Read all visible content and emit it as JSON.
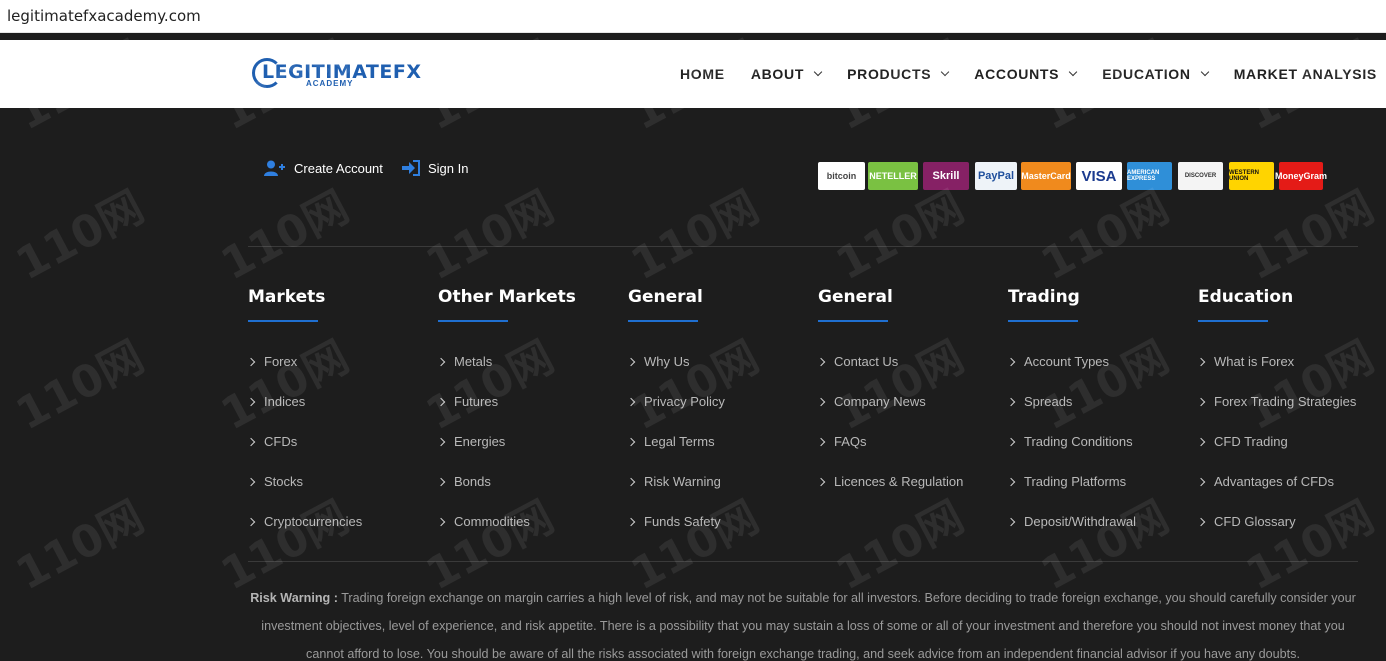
{
  "browser": {
    "url": "legitimatefxacademy.com"
  },
  "header": {
    "logo_text": "LEGITIMATEFX",
    "logo_sub": "ACADEMY",
    "nav": [
      {
        "label": "HOME",
        "dropdown": false
      },
      {
        "label": "ABOUT",
        "dropdown": true
      },
      {
        "label": "PRODUCTS",
        "dropdown": true
      },
      {
        "label": "ACCOUNTS",
        "dropdown": true
      },
      {
        "label": "EDUCATION",
        "dropdown": true
      },
      {
        "label": "MARKET ANALYSIS",
        "dropdown": true
      }
    ]
  },
  "account_links": {
    "create": "Create Account",
    "signin": "Sign In"
  },
  "payments": [
    {
      "name": "bitcoin",
      "label": "bitcoin",
      "bg": "#ffffff",
      "color": "#444"
    },
    {
      "name": "neteller",
      "label": "NETELLER",
      "bg": "#7ac142",
      "color": "#ffffff"
    },
    {
      "name": "skrill",
      "label": "Skrill",
      "bg": "#862165",
      "color": "#ffffff"
    },
    {
      "name": "paypal",
      "label": "PayPal",
      "bg": "#eef3f8",
      "color": "#1f4f9c"
    },
    {
      "name": "mastercard",
      "label": "MasterCard",
      "bg": "#f08a1d",
      "color": "#ffffff"
    },
    {
      "name": "visa",
      "label": "VISA",
      "bg": "#ffffff",
      "color": "#1a3a8f"
    },
    {
      "name": "amex",
      "label": "AMERICAN EXPRESS",
      "bg": "#2f8fd8",
      "color": "#ffffff"
    },
    {
      "name": "discover",
      "label": "DISCOVER",
      "bg": "#f4f4f4",
      "color": "#333"
    },
    {
      "name": "western-union",
      "label": "WESTERN UNION",
      "bg": "#ffd400",
      "color": "#111"
    },
    {
      "name": "moneygram",
      "label": "MoneyGram",
      "bg": "#e41b17",
      "color": "#ffffff"
    }
  ],
  "columns": [
    {
      "title": "Markets",
      "items": [
        "Forex",
        "Indices",
        "CFDs",
        "Stocks",
        "Cryptocurrencies"
      ]
    },
    {
      "title": "Other Markets",
      "items": [
        "Metals",
        "Futures",
        "Energies",
        "Bonds",
        "Commodities"
      ]
    },
    {
      "title": "General",
      "items": [
        "Why Us",
        "Privacy Policy",
        "Legal Terms",
        "Risk Warning",
        "Funds Safety"
      ]
    },
    {
      "title": "General",
      "items": [
        "Contact Us",
        "Company News",
        "FAQs",
        "Licences & Regulation"
      ]
    },
    {
      "title": "Trading",
      "items": [
        "Account Types",
        "Spreads",
        "Trading Conditions",
        "Trading Platforms",
        "Deposit/Withdrawal"
      ]
    },
    {
      "title": "Education",
      "items": [
        "What is Forex",
        "Forex Trading Strategies",
        "CFD Trading",
        "Advantages of CFDs",
        "CFD Glossary"
      ]
    }
  ],
  "risk": {
    "label": "Risk Warning :",
    "line1": "Trading foreign exchange on margin carries a high level of risk, and may not be suitable for all investors. Before deciding to trade foreign exchange, you should carefully consider your",
    "line2": "investment objectives, level of experience, and risk appetite. There is a possibility that you may sustain a loss of some or all of your investment and therefore you should not invest money that you",
    "line3": "cannot afford to lose. You should be aware of all the risks associated with foreign exchange trading, and seek advice from an independent financial advisor if you have any doubts."
  },
  "watermark": "110网"
}
